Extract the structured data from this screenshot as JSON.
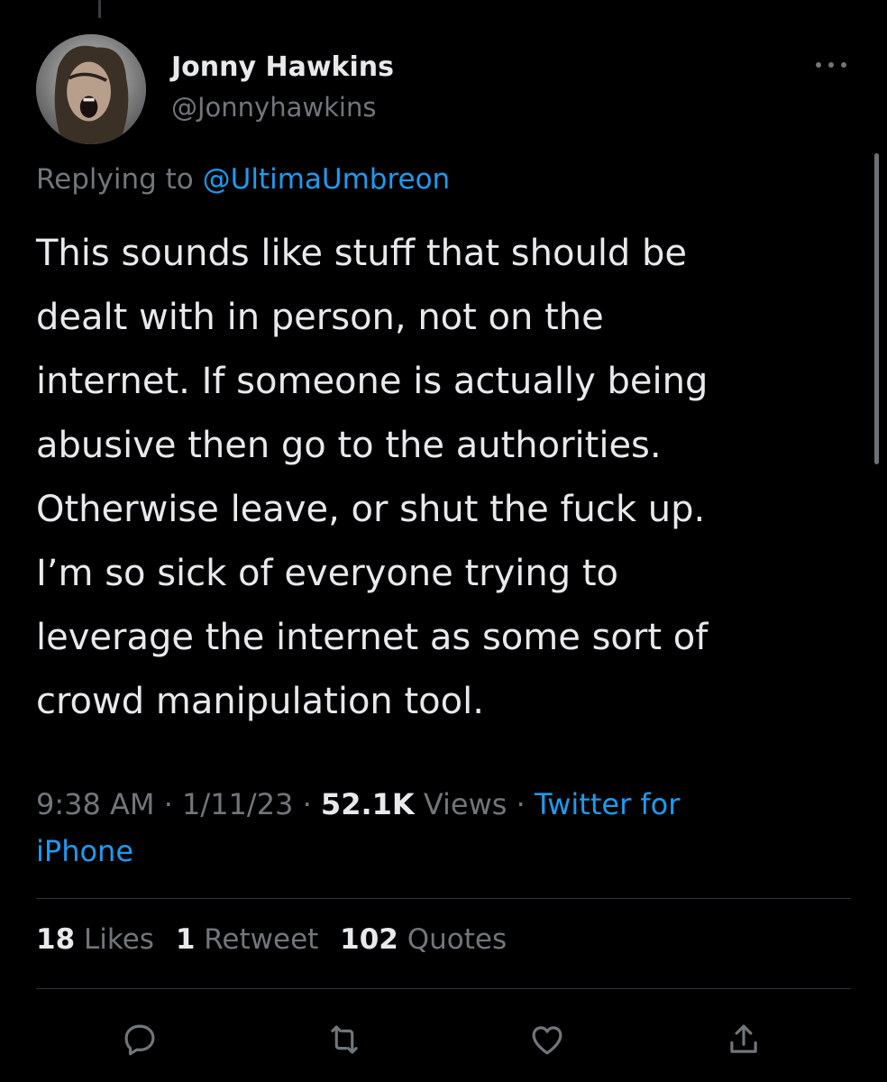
{
  "user": {
    "display_name": "Jonny Hawkins",
    "handle": "@Jonnyhawkins",
    "avatar_icon": "avatar"
  },
  "reply": {
    "prefix": "Replying to ",
    "handle": "@UltimaUmbreon"
  },
  "tweet": {
    "lines": [
      "This sounds like stuff that should be",
      "dealt with in person, not on the",
      "internet. If someone is actually being",
      "abusive then go to the authorities.",
      "Otherwise leave, or shut the fuck up.",
      "I’m so sick of everyone trying to",
      "leverage the internet as some sort of",
      "crowd manipulation tool."
    ]
  },
  "meta": {
    "time": "9:38 AM",
    "separator": " · ",
    "date": "1/11/23",
    "views_count": "52.1K",
    "views_label": " Views",
    "source_line1": "Twitter for",
    "source_line2": "iPhone"
  },
  "stats": {
    "likes_count": "18",
    "likes_label": "Likes",
    "retweets_count": "1",
    "retweets_label": "Retweet",
    "quotes_count": "102",
    "quotes_label": "Quotes"
  },
  "actions": [
    {
      "name": "reply-icon"
    },
    {
      "name": "retweet-icon"
    },
    {
      "name": "like-icon"
    },
    {
      "name": "share-icon"
    }
  ],
  "colors": {
    "background": "#000000",
    "text_primary": "#e7e9ea",
    "text_secondary": "#71767b",
    "accent": "#1d9bf0",
    "divider": "#2f3336"
  }
}
